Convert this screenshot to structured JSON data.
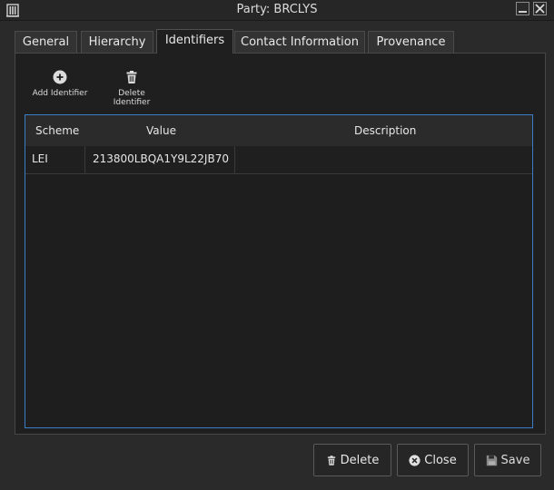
{
  "window": {
    "title": "Party: BRCLYS"
  },
  "tabs": [
    {
      "label": "General"
    },
    {
      "label": "Hierarchy"
    },
    {
      "label": "Identifiers"
    },
    {
      "label": "Contact Information"
    },
    {
      "label": "Provenance"
    }
  ],
  "active_tab": "Identifiers",
  "toolbar": {
    "add_label": "Add Identifier",
    "delete_label": "Delete Identifier"
  },
  "table": {
    "columns": [
      "Scheme",
      "Value",
      "Description"
    ],
    "rows": [
      {
        "scheme": "LEI",
        "value": "213800LBQA1Y9L22JB70",
        "description": ""
      }
    ]
  },
  "buttons": {
    "delete_label": "Delete",
    "close_label": "Close",
    "save_label": "Save"
  },
  "icons": {
    "app": "building-icon",
    "add": "plus-circle-icon",
    "delete": "trash-icon",
    "close": "x-circle-icon",
    "save": "floppy-disk-icon"
  },
  "colors": {
    "selection_border": "#3a7fc4",
    "background": "#1f1f1f"
  }
}
